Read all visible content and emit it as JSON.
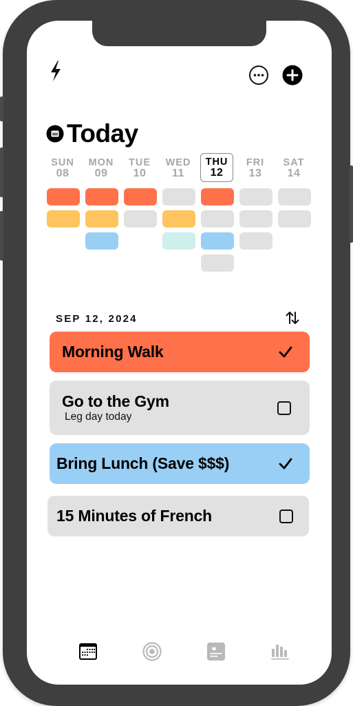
{
  "header": {
    "quick_icon": "bolt-icon",
    "more_icon": "ellipsis-circle-icon",
    "add_icon": "plus-circle-icon"
  },
  "title": {
    "icon": "calendar-badge-icon",
    "text": "Today"
  },
  "week": [
    {
      "dow": "SUN",
      "date": "08",
      "active": false
    },
    {
      "dow": "MON",
      "date": "09",
      "active": false
    },
    {
      "dow": "TUE",
      "date": "10",
      "active": false
    },
    {
      "dow": "WED",
      "date": "11",
      "active": false
    },
    {
      "dow": "THU",
      "date": "12",
      "active": true
    },
    {
      "dow": "FRI",
      "date": "13",
      "active": false
    },
    {
      "dow": "SAT",
      "date": "14",
      "active": false
    }
  ],
  "habit_grid": [
    [
      "orange",
      "yellow"
    ],
    [
      "orange",
      "yellow",
      "blue"
    ],
    [
      "orange",
      "gray"
    ],
    [
      "gray",
      "yellow",
      "mint"
    ],
    [
      "orange",
      "gray",
      "blue",
      "gray"
    ],
    [
      "gray",
      "gray",
      "gray"
    ],
    [
      "gray",
      "gray"
    ]
  ],
  "colors": {
    "orange": "#ff714a",
    "yellow": "#ffc45e",
    "blue": "#9acff5",
    "mint": "#cfefec",
    "gray": "#e1e1e1",
    "bezel": "#3f3f3f",
    "inactive_icon": "#b9b9b9"
  },
  "list": {
    "date_label": "SEP 12, 2024",
    "sort_icon": "sort-arrows-icon",
    "tasks": [
      {
        "name": "Morning Walk",
        "subtitle": "",
        "done": true,
        "color": "orange"
      },
      {
        "name": "Go to the Gym",
        "subtitle": "Leg day today",
        "done": false,
        "color": "gray"
      },
      {
        "name": "Bring Lunch (Save $$$)",
        "subtitle": "",
        "done": true,
        "color": "blue"
      },
      {
        "name": "15 Minutes of French",
        "subtitle": "",
        "done": false,
        "color": "gray"
      }
    ]
  },
  "tabbar": [
    {
      "name": "calendar",
      "icon": "calendar-icon",
      "active": true
    },
    {
      "name": "goals",
      "icon": "target-icon",
      "active": false
    },
    {
      "name": "journal",
      "icon": "heart-card-icon",
      "active": false
    },
    {
      "name": "stats",
      "icon": "bar-chart-icon",
      "active": false
    }
  ]
}
